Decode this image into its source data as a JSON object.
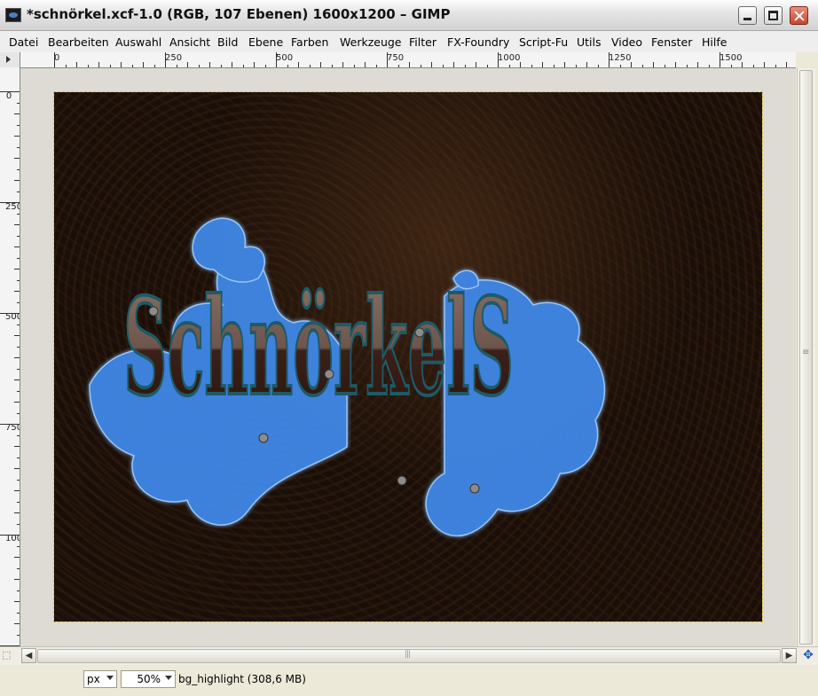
{
  "window": {
    "title": "*schnörkel.xcf-1.0 (RGB, 107 Ebenen) 1600x1200 – GIMP"
  },
  "menu": {
    "items": [
      {
        "label": "Datei"
      },
      {
        "label": "Bearbeiten"
      },
      {
        "label": "Auswahl"
      },
      {
        "label": "Ansicht"
      },
      {
        "label": "Bild"
      },
      {
        "label": "Ebene"
      },
      {
        "label": "Farben"
      },
      {
        "label": "Werkzeuge"
      },
      {
        "label": "Filter"
      },
      {
        "label": "FX-Foundry"
      },
      {
        "label": "Script-Fu"
      },
      {
        "label": "Utils"
      },
      {
        "label": "Video"
      },
      {
        "label": "Fenster"
      },
      {
        "label": "Hilfe"
      }
    ]
  },
  "ruler": {
    "top_labels": [
      "0",
      "250",
      "500",
      "750",
      "1000",
      "1250",
      "1500"
    ],
    "left_labels": [
      "0",
      "250",
      "500",
      "750",
      "1000"
    ]
  },
  "canvas": {
    "artwork_text": "SchnörkelS",
    "colors": {
      "background": "#1a0f08",
      "swirl": "#3f88e8",
      "swirl_highlight": "#9fd0ff",
      "letters": "#6e564c",
      "letter_outline": "#1e5a66"
    }
  },
  "statusbar": {
    "unit": "px",
    "zoom": "50%",
    "message": "bg_highlight (308,6 MB)"
  }
}
